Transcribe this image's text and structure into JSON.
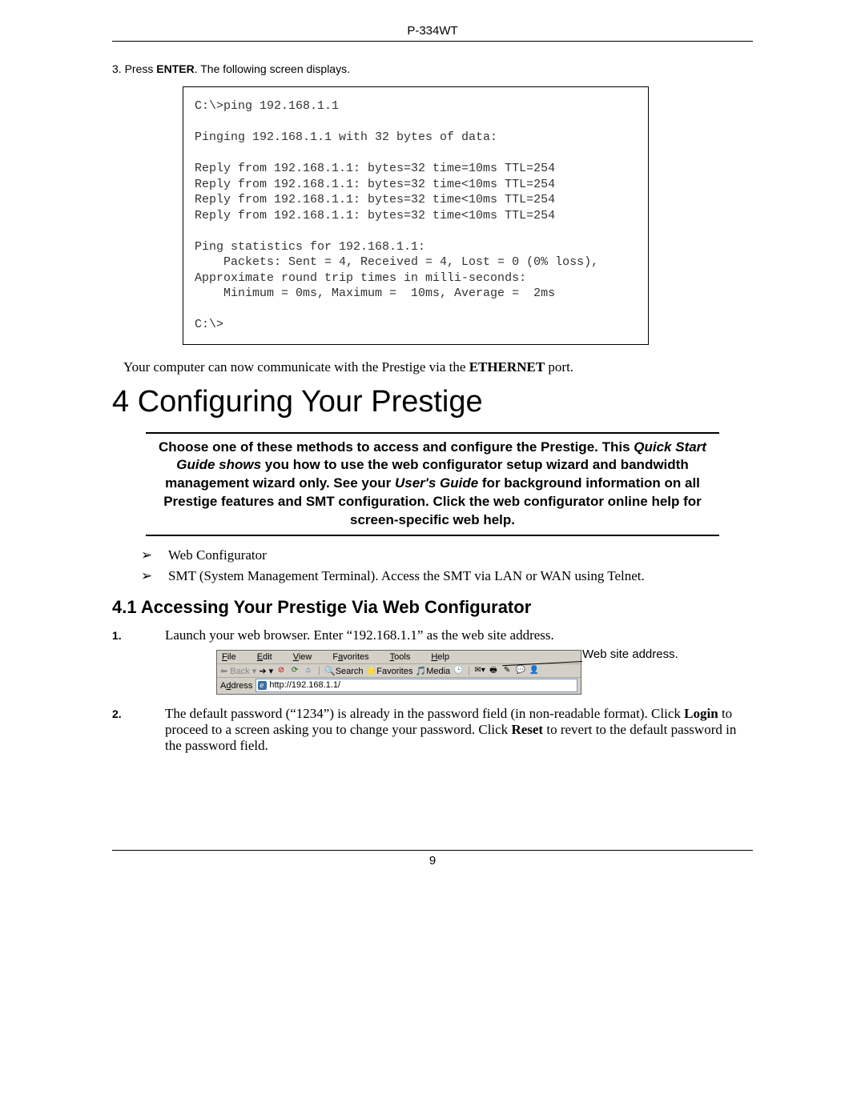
{
  "header": {
    "model": "P-334WT"
  },
  "step3": {
    "prefix": "3. Press ",
    "bold": "ENTER",
    "suffix": ". The following screen displays."
  },
  "console": "C:\\>ping 192.168.1.1\n\nPinging 192.168.1.1 with 32 bytes of data:\n\nReply from 192.168.1.1: bytes=32 time=10ms TTL=254\nReply from 192.168.1.1: bytes=32 time<10ms TTL=254\nReply from 192.168.1.1: bytes=32 time<10ms TTL=254\nReply from 192.168.1.1: bytes=32 time<10ms TTL=254\n\nPing statistics for 192.168.1.1:\n    Packets: Sent = 4, Received = 4, Lost = 0 (0% loss),\nApproximate round trip times in milli-seconds:\n    Minimum = 0ms, Maximum =  10ms, Average =  2ms\n\nC:\\>",
  "para_ethernet": {
    "pre": "Your computer can now communicate with the Prestige via the ",
    "bold": "ETHERNET",
    "post": " port."
  },
  "h1": "4 Configuring Your Prestige",
  "callout": {
    "t1": "Choose one of these methods to access and configure the Prestige. This ",
    "i1": "Quick Start Guide shows",
    "t2": " you how to use the web configurator setup wizard and bandwidth management wizard only. See your ",
    "i2": "User's Guide",
    "t3": " for background information on all Prestige features and SMT configuration. Click the web configurator online help for screen-specific web help."
  },
  "bullets": [
    "Web Configurator",
    "SMT (System Management Terminal). Access the SMT via LAN or WAN using Telnet."
  ],
  "h2": "4.1 Accessing Your Prestige Via Web Configurator",
  "ol": {
    "n1": "1.",
    "t1": "Launch your web browser. Enter “192.168.1.1” as the web site address.",
    "n2": "2.",
    "t2a": "The default password (“1234”) is already in the password field (in non-readable format). Click ",
    "t2b": "Login",
    "t2c": " to proceed to a screen asking you to change your password. Click ",
    "t2d": "Reset",
    "t2e": " to revert to the default password in the password field."
  },
  "browser": {
    "menus": {
      "file": "File",
      "edit": "Edit",
      "view": "View",
      "fav": "Favorites",
      "tools": "Tools",
      "help": "Help"
    },
    "toolbar": {
      "back": "Back",
      "search": "Search",
      "favorites": "Favorites",
      "media": "Media"
    },
    "addr_label": "Address",
    "addr_value": "http://192.168.1.1/",
    "callout": "Web site address."
  },
  "footer": {
    "page": "9"
  },
  "glyphs": {
    "arrow": "➢"
  }
}
